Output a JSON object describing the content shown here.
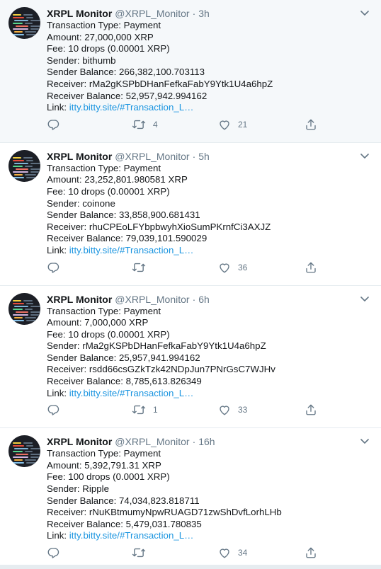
{
  "tweets": [
    {
      "name": "XRPL Monitor",
      "handle": "@XRPL_Monitor",
      "time": "3h",
      "lines": [
        "Transaction Type: Payment",
        "Amount: 27,000,000 XRP",
        "Fee: 10 drops (0.00001 XRP)",
        "Sender: bithumb",
        "Sender Balance: 266,382,100.703113",
        "Receiver: rMa2gKSPbDHanFefkaFabY9Ytk1U4a6hpZ",
        "Receiver Balance: 52,957,942.994162"
      ],
      "link_label": "Link:",
      "link_text": "itty.bitty.site/#Transaction_L…",
      "retweets": "4",
      "likes": "21"
    },
    {
      "name": "XRPL Monitor",
      "handle": "@XRPL_Monitor",
      "time": "5h",
      "lines": [
        "Transaction Type: Payment",
        "Amount: 23,252,801.980581 XRP",
        "Fee: 10 drops (0.00001 XRP)",
        "Sender: coinone",
        "Sender Balance: 33,858,900.681431",
        "Receiver: rhuCPEoLFYbpbwyhXioSumPKrnfCi3AXJZ",
        "Receiver Balance: 79,039,101.590029"
      ],
      "link_label": "Link:",
      "link_text": "itty.bitty.site/#Transaction_L…",
      "retweets": "",
      "likes": "36"
    },
    {
      "name": "XRPL Monitor",
      "handle": "@XRPL_Monitor",
      "time": "6h",
      "lines": [
        "Transaction Type: Payment",
        "Amount: 7,000,000 XRP",
        "Fee: 10 drops (0.00001 XRP)",
        "Sender: rMa2gKSPbDHanFefkaFabY9Ytk1U4a6hpZ",
        "Sender Balance: 25,957,941.994162",
        "Receiver: rsdd66csGZkTzk42NDpJun7PNrGsC7WJHv",
        "Receiver Balance: 8,785,613.826349"
      ],
      "link_label": "Link:",
      "link_text": "itty.bitty.site/#Transaction_L…",
      "retweets": "1",
      "likes": "33"
    },
    {
      "name": "XRPL Monitor",
      "handle": "@XRPL_Monitor",
      "time": "16h",
      "lines": [
        "Transaction Type: Payment",
        "Amount: 5,392,791.31 XRP",
        "Fee: 100 drops (0.0001 XRP)",
        "Sender: Ripple",
        "Sender Balance: 74,034,823.818711",
        "Receiver: rNuKBtmumyNpwRUAGD71zwShDvfLorhLHb",
        "Receiver Balance: 5,479,031.780835"
      ],
      "link_label": "Link:",
      "link_text": "itty.bitty.site/#Transaction_L…",
      "retweets": "",
      "likes": "34"
    }
  ],
  "icons": {
    "reply": "reply-icon",
    "retweet": "retweet-icon",
    "like": "heart-icon",
    "share": "share-icon",
    "caret": "chevron-down-icon"
  },
  "colors": {
    "link": "#1b95e0",
    "muted": "#657786",
    "highlight_bg": "#f5f8fa",
    "divider": "#e6ecf0"
  }
}
